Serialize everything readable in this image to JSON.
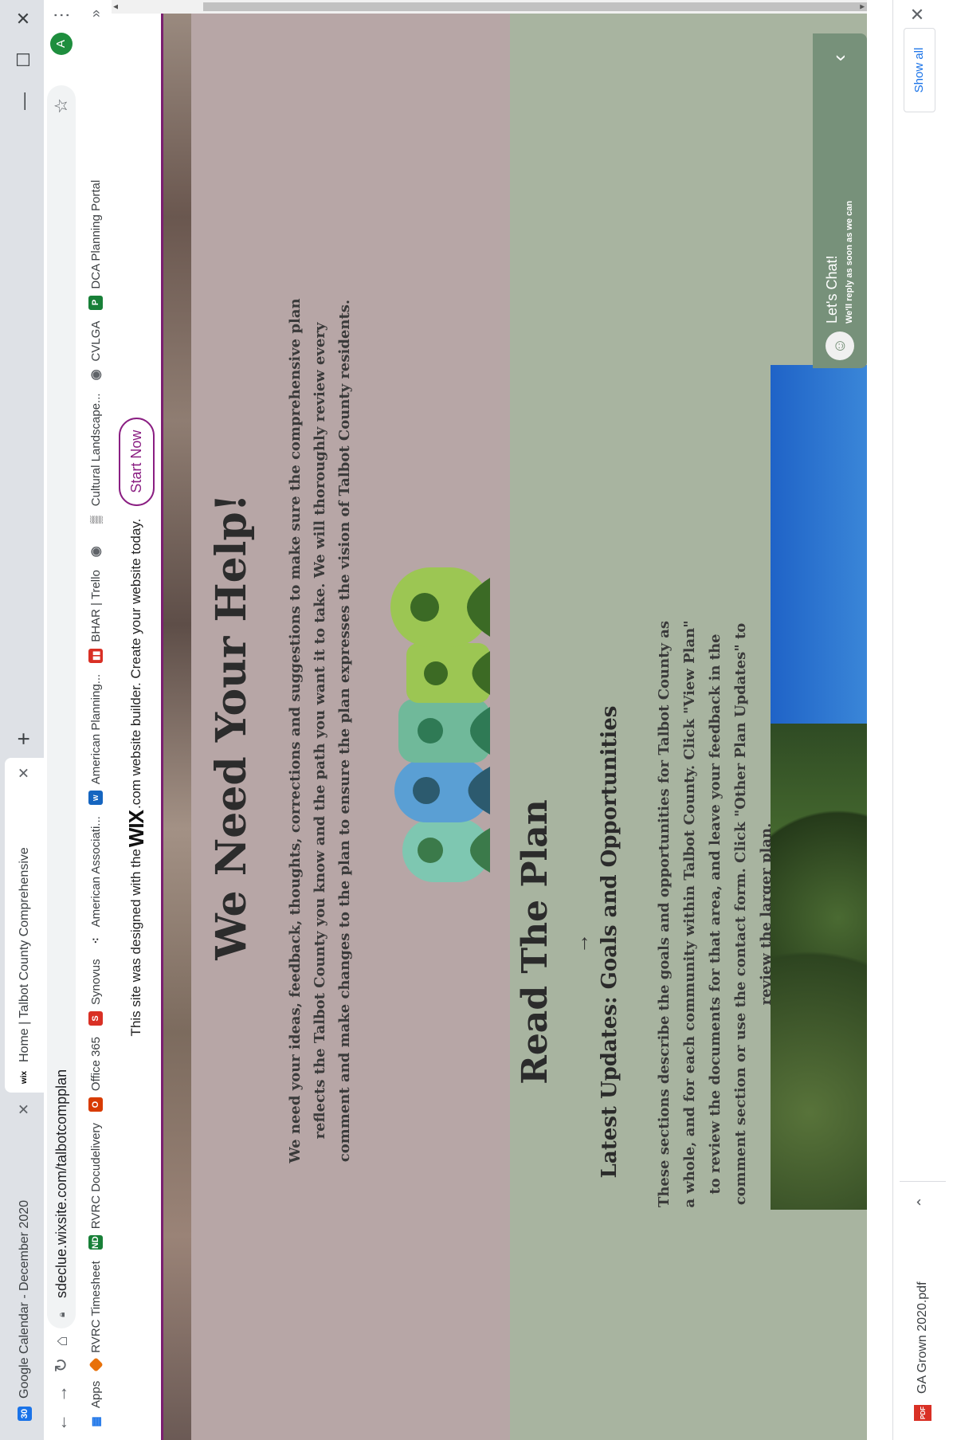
{
  "tabs": [
    {
      "title": "Google Calendar - December 2020",
      "favicon": "30"
    },
    {
      "title": "Home | Talbot County Comprehensive",
      "favicon": "wix"
    }
  ],
  "window": {
    "minimize": "—",
    "maximize": "☐",
    "close": "✕"
  },
  "address": {
    "url": "sdeclue.wixsite.com/talbotcompplan"
  },
  "profile_initial": "A",
  "bookmarks": [
    {
      "label": "Apps",
      "icon": "apps-grid-icon",
      "color": "#1a73e8"
    },
    {
      "label": "RVRC Timesheet",
      "icon": "timesheet-icon",
      "color": "#e8710a"
    },
    {
      "label": "RVRC Docudelivery",
      "icon": "docudelivery-icon",
      "color": "#188038"
    },
    {
      "label": "Office 365",
      "icon": "office-icon",
      "color": "#d83b01"
    },
    {
      "label": "Synovus",
      "icon": "synovus-icon",
      "color": "#d93025"
    },
    {
      "label": "American Associati...",
      "icon": "dots-icon",
      "color": "#202124"
    },
    {
      "label": "American Planning...",
      "icon": "apa-icon",
      "color": "#1565c0"
    },
    {
      "label": "BHAR | Trello",
      "icon": "trello-icon",
      "color": "#d93025"
    },
    {
      "label": "",
      "icon": "globe-icon",
      "color": "#5f6368"
    },
    {
      "label": "Cultural Landscape...",
      "icon": "cultural-icon",
      "color": "#202124"
    },
    {
      "label": "CVLGA",
      "icon": "globe-icon",
      "color": "#5f6368"
    },
    {
      "label": "DCA Planning Portal",
      "icon": "dca-icon",
      "color": "#188038"
    }
  ],
  "banner": {
    "text_before": "This site was designed with the",
    "wix": "WIX",
    "text_after": ".com website builder. Create your website today.",
    "button": "Start Now"
  },
  "help": {
    "heading": "We Need Your Help!",
    "body": "We need your ideas, feedback, thoughts, corrections and suggestions to make sure the comprehensive plan reflects the Talbot County you know and the path you want it to take. We will thoroughly review every comment and make changes to the plan to ensure the plan expresses the vision of Talbot County residents."
  },
  "plan": {
    "heading": "Read The Plan",
    "arrow": "→",
    "subheading": "Latest Updates: Goals and Opportunities",
    "body": "These sections describe the goals and opportunities for Talbot County as a whole, and for each community within Talbot County. Click \"View Plan\" to review the documents for that area, and leave your feedback in the comment section or use the contact form. Click \"Other Plan Updates\" to review the larger plan."
  },
  "chat": {
    "title": "Let's Chat!",
    "subtitle": "We'll reply as soon as we can"
  },
  "downloads": {
    "file": "GA Grown 2020.pdf",
    "show_all": "Show all"
  },
  "colors": {
    "help_bg": "#b7a6a6",
    "plan_bg": "#a8b4a0",
    "chat_bg": "#77917a",
    "wix_accent": "#8a1e82"
  }
}
